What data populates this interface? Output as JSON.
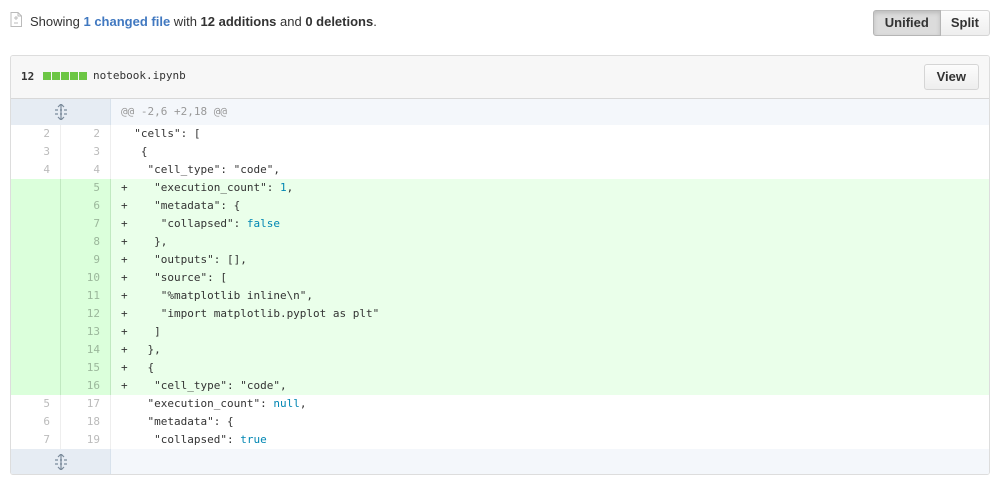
{
  "toc": {
    "prefix": "Showing ",
    "changed_link": "1 changed file",
    "mid": " with ",
    "additions": "12 additions",
    "and": " and ",
    "deletions": "0 deletions",
    "end": "."
  },
  "view_toggle": {
    "unified": "Unified",
    "split": "Split",
    "selected": "Unified"
  },
  "file": {
    "diffstat_count": "12",
    "diffstat_blocks": 5,
    "diffstat_color": "#6cc644",
    "name": "notebook.ipynb",
    "view_label": "View"
  },
  "hunk": {
    "header": "@@ -2,6 +2,18 @@"
  },
  "lines": [
    {
      "old": "2",
      "new": "2",
      "type": "ctx",
      "text": "  \"cells\": ["
    },
    {
      "old": "3",
      "new": "3",
      "type": "ctx",
      "text": "   {"
    },
    {
      "old": "4",
      "new": "4",
      "type": "ctx",
      "text": "    \"cell_type\": \"code\","
    },
    {
      "old": "",
      "new": "5",
      "type": "add",
      "text": "+    \"execution_count\": 1,"
    },
    {
      "old": "",
      "new": "6",
      "type": "add",
      "text": "+    \"metadata\": {"
    },
    {
      "old": "",
      "new": "7",
      "type": "add",
      "text": "+     \"collapsed\": false"
    },
    {
      "old": "",
      "new": "8",
      "type": "add",
      "text": "+    },"
    },
    {
      "old": "",
      "new": "9",
      "type": "add",
      "text": "+    \"outputs\": [],"
    },
    {
      "old": "",
      "new": "10",
      "type": "add",
      "text": "+    \"source\": ["
    },
    {
      "old": "",
      "new": "11",
      "type": "add",
      "text": "+     \"%matplotlib inline\\n\","
    },
    {
      "old": "",
      "new": "12",
      "type": "add",
      "text": "+     \"import matplotlib.pyplot as plt\""
    },
    {
      "old": "",
      "new": "13",
      "type": "add",
      "text": "+    ]"
    },
    {
      "old": "",
      "new": "14",
      "type": "add",
      "text": "+   },"
    },
    {
      "old": "",
      "new": "15",
      "type": "add",
      "text": "+   {"
    },
    {
      "old": "",
      "new": "16",
      "type": "add",
      "text": "+    \"cell_type\": \"code\","
    },
    {
      "old": "5",
      "new": "17",
      "type": "ctx",
      "text": "    \"execution_count\": null,"
    },
    {
      "old": "6",
      "new": "18",
      "type": "ctx",
      "text": "    \"metadata\": {"
    },
    {
      "old": "7",
      "new": "19",
      "type": "ctx",
      "text": "     \"collapsed\": true"
    }
  ],
  "colors": {
    "link": "#4078c0",
    "addition_bg": "#eaffea",
    "addition_gutter": "#dbffdb",
    "hunk_bg": "#f4f7fb"
  },
  "icons": {
    "toc": "file-diff-icon",
    "expand": "unfold-icon"
  }
}
